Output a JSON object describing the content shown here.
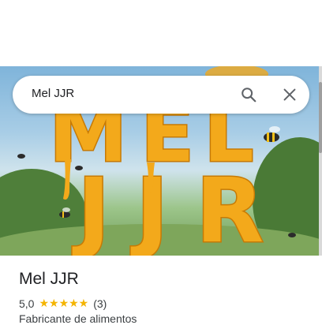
{
  "search": {
    "query": "Mel JJR"
  },
  "hero_image": {
    "text": "MEL JJR"
  },
  "place": {
    "name": "Mel JJR",
    "rating": "5,0",
    "stars": "★★★★★",
    "review_count": "(3)",
    "category": "Fabricante de alimentos"
  },
  "colors": {
    "star": "#f4b400",
    "honey": "#f3a91b"
  }
}
